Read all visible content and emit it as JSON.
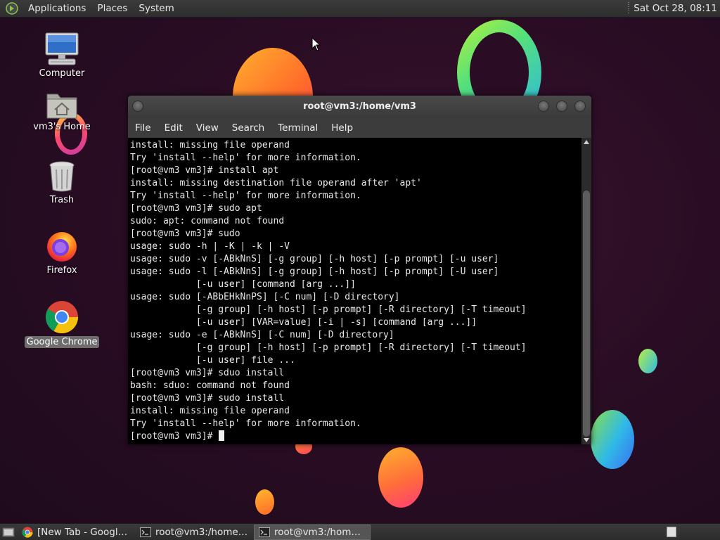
{
  "top_panel": {
    "menus": [
      "Applications",
      "Places",
      "System"
    ],
    "clock": "Sat Oct 28, 08:11"
  },
  "desktop_icons": [
    {
      "label": "Computer",
      "icon": "computer-icon"
    },
    {
      "label": "vm3's Home",
      "icon": "home-folder-icon"
    },
    {
      "label": "Trash",
      "icon": "trash-icon"
    },
    {
      "label": "Firefox",
      "icon": "firefox-icon"
    },
    {
      "label": "Google Chrome",
      "icon": "chrome-icon",
      "selected": true
    }
  ],
  "terminal_window": {
    "title": "root@vm3:/home/vm3",
    "menu": [
      "File",
      "Edit",
      "View",
      "Search",
      "Terminal",
      "Help"
    ],
    "lines": [
      "install: missing file operand",
      "Try 'install --help' for more information.",
      "[root@vm3 vm3]# install apt",
      "install: missing destination file operand after 'apt'",
      "Try 'install --help' for more information.",
      "[root@vm3 vm3]# sudo apt",
      "sudo: apt: command not found",
      "[root@vm3 vm3]# sudo",
      "usage: sudo -h | -K | -k | -V",
      "usage: sudo -v [-ABkNnS] [-g group] [-h host] [-p prompt] [-u user]",
      "usage: sudo -l [-ABkNnS] [-g group] [-h host] [-p prompt] [-U user]",
      "            [-u user] [command [arg ...]]",
      "usage: sudo [-ABbEHkNnPS] [-C num] [-D directory]",
      "            [-g group] [-h host] [-p prompt] [-R directory] [-T timeout]",
      "            [-u user] [VAR=value] [-i | -s] [command [arg ...]]",
      "usage: sudo -e [-ABkNnS] [-C num] [-D directory]",
      "            [-g group] [-h host] [-p prompt] [-R directory] [-T timeout]",
      "            [-u user] file ...",
      "[root@vm3 vm3]# sduo install",
      "bash: sduo: command not found",
      "[root@vm3 vm3]# sudo install",
      "install: missing file operand",
      "Try 'install --help' for more information."
    ],
    "prompt": "[root@vm3 vm3]# "
  },
  "taskbar": {
    "tasks": [
      {
        "label": "[New Tab - Google ...",
        "icon": "chrome-icon",
        "active": false
      },
      {
        "label": "root@vm3:/home/v...",
        "icon": "terminal-icon",
        "active": false
      },
      {
        "label": "root@vm3:/home/v...",
        "icon": "terminal-icon",
        "active": true
      }
    ]
  },
  "colors": {
    "wallpaper": "#2a0d24",
    "panel": "#333333",
    "terminal_bg": "#000000",
    "terminal_fg": "#e8e8e8"
  }
}
